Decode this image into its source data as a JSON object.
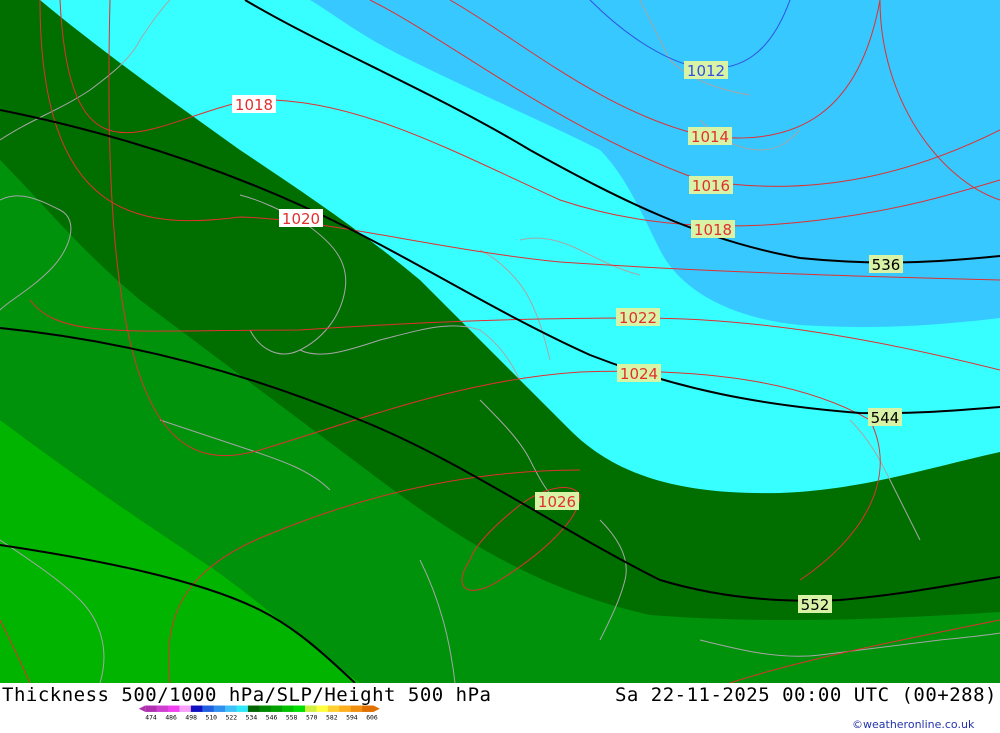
{
  "map": {
    "title": "Thickness 500/1000 hPa/SLP/Height 500 hPa",
    "valid_time": "Sa 22-11-2025 00:00 UTC (00+288)",
    "credit": "©weatheronline.co.uk",
    "isobar_labels": [
      "1012",
      "1014",
      "1016",
      "1018",
      "1018",
      "1020",
      "1022",
      "1024",
      "1026"
    ],
    "height_labels": [
      "536",
      "544",
      "552"
    ],
    "legend": {
      "values": [
        "474",
        "486",
        "498",
        "510",
        "522",
        "534",
        "546",
        "558",
        "570",
        "582",
        "594",
        "606"
      ],
      "colors": [
        "#b030b0",
        "#d040d0",
        "#f040f0",
        "#f8a0f8",
        "#1010c0",
        "#2060e0",
        "#3090f0",
        "#40c0f8",
        "#30e8f8",
        "#006400",
        "#008800",
        "#00a000",
        "#00c000",
        "#00e000",
        "#d0f040",
        "#ffff40",
        "#ffd030",
        "#ffb020",
        "#f09010",
        "#e07000"
      ]
    },
    "colors": {
      "deep_blue": "#36c8ff",
      "cyan": "#38ffff",
      "dark_green": "#006f00",
      "mid_green": "#00920a",
      "light_green": "#00b400",
      "isobar": "#e03030",
      "height_contour": "#000000",
      "coast": "#a0a0a0"
    }
  }
}
